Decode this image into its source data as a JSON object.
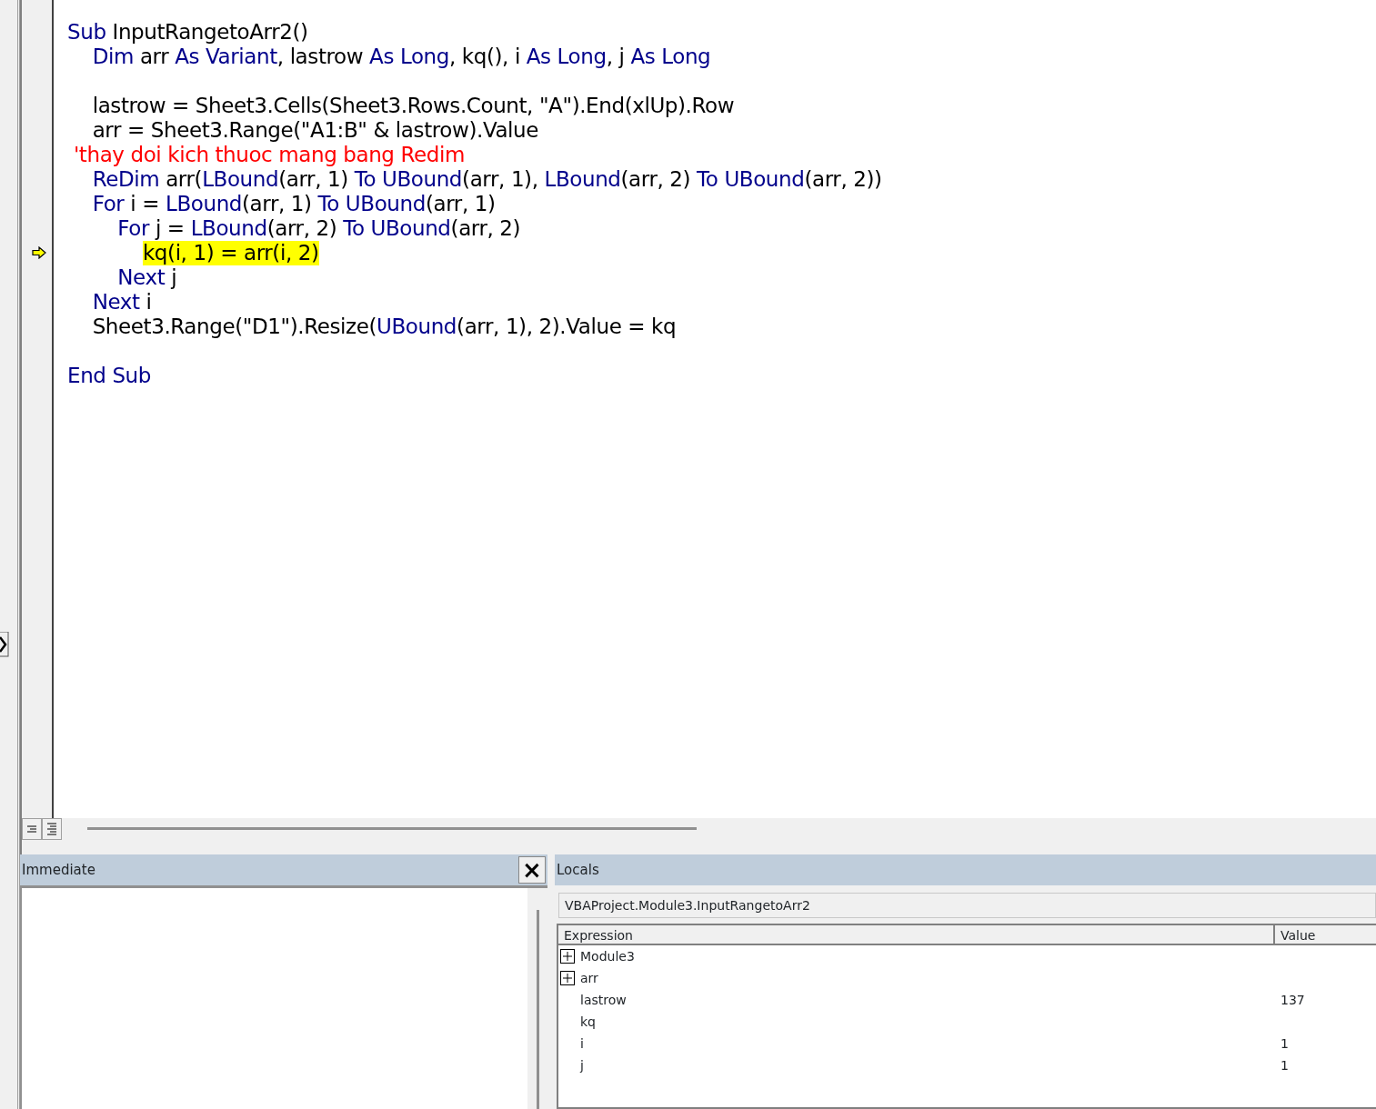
{
  "code_window": {
    "lines": [
      {
        "kind": "code",
        "highlighted": false,
        "current": false,
        "segments": [
          {
            "kind": "keyword",
            "text": "Sub "
          },
          {
            "kind": "text",
            "text": "InputRangetoArr2()"
          }
        ]
      },
      {
        "kind": "code",
        "highlighted": false,
        "current": false,
        "segments": [
          {
            "kind": "keyword",
            "text": "    Dim "
          },
          {
            "kind": "text",
            "text": "arr "
          },
          {
            "kind": "keyword",
            "text": "As Variant"
          },
          {
            "kind": "text",
            "text": ", lastrow "
          },
          {
            "kind": "keyword",
            "text": "As Long"
          },
          {
            "kind": "text",
            "text": ", kq(), i "
          },
          {
            "kind": "keyword",
            "text": "As Long"
          },
          {
            "kind": "text",
            "text": ", j "
          },
          {
            "kind": "keyword",
            "text": "As Long"
          }
        ]
      },
      {
        "kind": "blank"
      },
      {
        "kind": "code",
        "highlighted": false,
        "current": false,
        "segments": [
          {
            "kind": "text",
            "text": "    lastrow = Sheet3.Cells(Sheet3.Rows.Count, \"A\").End(xlUp).Row"
          }
        ]
      },
      {
        "kind": "code",
        "highlighted": false,
        "current": false,
        "segments": [
          {
            "kind": "text",
            "text": "    arr = Sheet3.Range(\"A1:B\" & lastrow).Value"
          }
        ]
      },
      {
        "kind": "code",
        "highlighted": false,
        "current": false,
        "segments": [
          {
            "kind": "comment",
            "text": " 'thay doi kich thuoc mang bang Redim"
          }
        ]
      },
      {
        "kind": "code",
        "highlighted": false,
        "current": false,
        "segments": [
          {
            "kind": "keyword",
            "text": "    ReDim "
          },
          {
            "kind": "text",
            "text": "arr("
          },
          {
            "kind": "keyword",
            "text": "LBound"
          },
          {
            "kind": "text",
            "text": "(arr, 1) "
          },
          {
            "kind": "keyword",
            "text": "To UBound"
          },
          {
            "kind": "text",
            "text": "(arr, 1), "
          },
          {
            "kind": "keyword",
            "text": "LBound"
          },
          {
            "kind": "text",
            "text": "(arr, 2) "
          },
          {
            "kind": "keyword",
            "text": "To UBound"
          },
          {
            "kind": "text",
            "text": "(arr, 2))"
          }
        ]
      },
      {
        "kind": "code",
        "highlighted": false,
        "current": false,
        "segments": [
          {
            "kind": "keyword",
            "text": "    For "
          },
          {
            "kind": "text",
            "text": "i = "
          },
          {
            "kind": "keyword",
            "text": "LBound"
          },
          {
            "kind": "text",
            "text": "(arr, 1) "
          },
          {
            "kind": "keyword",
            "text": "To UBound"
          },
          {
            "kind": "text",
            "text": "(arr, 1)"
          }
        ]
      },
      {
        "kind": "code",
        "highlighted": false,
        "current": false,
        "segments": [
          {
            "kind": "keyword",
            "text": "        For "
          },
          {
            "kind": "text",
            "text": "j = "
          },
          {
            "kind": "keyword",
            "text": "LBound"
          },
          {
            "kind": "text",
            "text": "(arr, 2) "
          },
          {
            "kind": "keyword",
            "text": "To UBound"
          },
          {
            "kind": "text",
            "text": "(arr, 2)"
          }
        ]
      },
      {
        "kind": "code",
        "highlighted": true,
        "current": true,
        "segments": [
          {
            "kind": "text",
            "text": "            kq(i, 1) = arr(i, 2)"
          }
        ]
      },
      {
        "kind": "code",
        "highlighted": false,
        "current": false,
        "segments": [
          {
            "kind": "keyword",
            "text": "        Next "
          },
          {
            "kind": "text",
            "text": "j"
          }
        ]
      },
      {
        "kind": "code",
        "highlighted": false,
        "current": false,
        "segments": [
          {
            "kind": "keyword",
            "text": "    Next "
          },
          {
            "kind": "text",
            "text": "i"
          }
        ]
      },
      {
        "kind": "code",
        "highlighted": false,
        "current": false,
        "segments": [
          {
            "kind": "text",
            "text": "    Sheet3.Range(\"D1\").Resize("
          },
          {
            "kind": "keyword",
            "text": "UBound"
          },
          {
            "kind": "text",
            "text": "(arr, 1), 2).Value = kq"
          }
        ]
      },
      {
        "kind": "blank"
      },
      {
        "kind": "code",
        "highlighted": false,
        "current": false,
        "segments": [
          {
            "kind": "keyword",
            "text": "End Sub"
          }
        ]
      }
    ]
  },
  "immediate": {
    "title": "Immediate",
    "close": "×"
  },
  "locals": {
    "title": "Locals",
    "context": "VBAProject.Module3.InputRangetoArr2",
    "columns": [
      "Expression",
      "Value"
    ],
    "rows": [
      {
        "expression": "Module3",
        "expandable": true
      },
      {
        "expression": "arr",
        "expandable": true
      },
      {
        "expression": "lastrow",
        "expandable": false,
        "value": "137"
      },
      {
        "expression": "kq",
        "expandable": false
      },
      {
        "expression": "i",
        "expandable": false,
        "value": "1"
      },
      {
        "expression": "j",
        "expandable": false,
        "value": "1"
      }
    ]
  }
}
